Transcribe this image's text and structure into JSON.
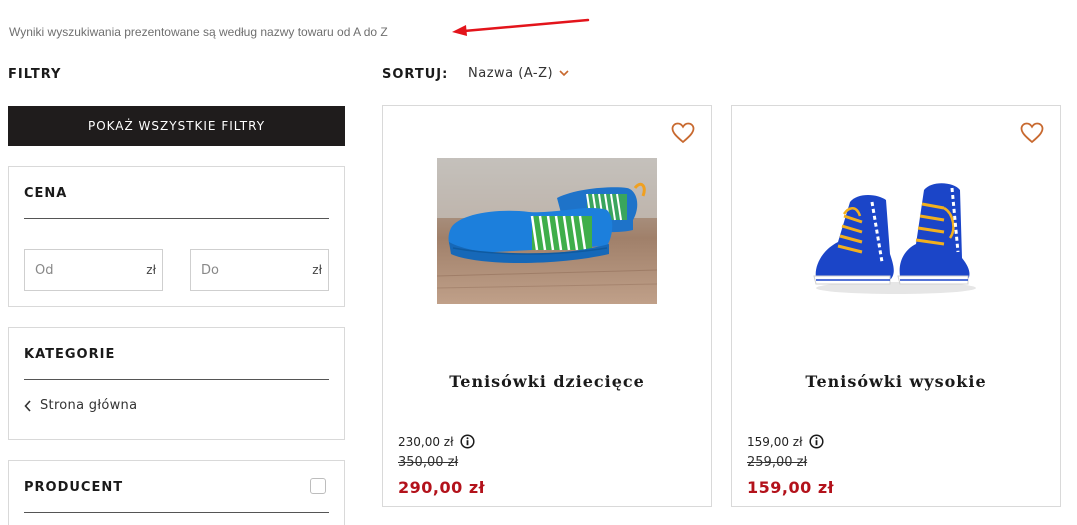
{
  "note": "Wyniki wyszukiwania prezentowane są według nazwy towaru od A do Z",
  "filters": {
    "title": "FILTRY",
    "show_all_label": "POKAŻ WSZYSTKIE FILTRY",
    "price": {
      "title": "CENA",
      "from_placeholder": "Od",
      "to_placeholder": "Do",
      "currency": "zł"
    },
    "categories": {
      "title": "KATEGORIE",
      "link_label": "Strona główna"
    },
    "producer": {
      "title": "PRODUCENT"
    }
  },
  "sort": {
    "label": "SORTUJ:",
    "value": "Nazwa (A-Z)"
  },
  "colors": {
    "accent": "#c8692f",
    "sale_price": "#b3121b",
    "button_bg": "#1f1c1c",
    "annotation_arrow": "#e3141b"
  },
  "products": [
    {
      "name": "Tenisówki dziecięce",
      "base_price": "230,00 zł",
      "old_price": "350,00 zł",
      "price": "290,00 zł"
    },
    {
      "name": "Tenisówki wysokie",
      "base_price": "159,00 zł",
      "old_price": "259,00 zł",
      "price": "159,00 zł"
    }
  ]
}
